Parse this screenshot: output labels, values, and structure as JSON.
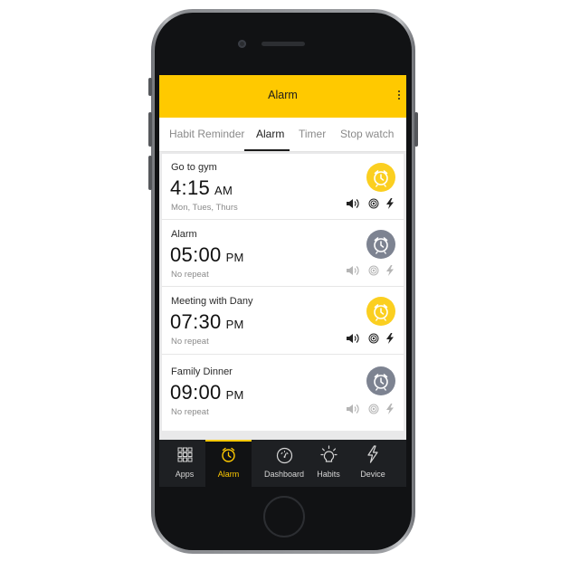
{
  "app": {
    "title": "Alarm"
  },
  "tabs": [
    {
      "label": "Habit Reminder",
      "active": false
    },
    {
      "label": "Alarm",
      "active": true
    },
    {
      "label": "Timer",
      "active": false
    },
    {
      "label": "Stop watch",
      "active": false
    }
  ],
  "alarms": [
    {
      "name": "Go to gym",
      "time": "4:15",
      "ampm": "AM",
      "repeat": "Mon, Tues, Thurs",
      "enabled": true
    },
    {
      "name": "Alarm",
      "time": "05:00",
      "ampm": "PM",
      "repeat": "No repeat",
      "enabled": false
    },
    {
      "name": "Meeting with Dany",
      "time": "07:30",
      "ampm": "PM",
      "repeat": "No repeat",
      "enabled": true
    },
    {
      "name": "Family Dinner",
      "time": "09:00",
      "ampm": "PM",
      "repeat": "No repeat",
      "enabled": false
    }
  ],
  "alarm_icons": [
    "alarm-clock-icon",
    "speaker-icon",
    "vibrate-icon",
    "flash-icon"
  ],
  "bottom_nav": [
    {
      "label": "Apps",
      "icon": "grid-icon",
      "active": false
    },
    {
      "label": "Alarm",
      "icon": "alarm-clock-icon",
      "active": true
    },
    {
      "label": "Dashboard",
      "icon": "gauge-icon",
      "active": false
    },
    {
      "label": "Habits",
      "icon": "lightbulb-icon",
      "active": false
    },
    {
      "label": "Device",
      "icon": "flash-icon",
      "active": false
    }
  ],
  "colors": {
    "accent": "#ffc900",
    "alarm_on": "#fbcf20",
    "alarm_off": "#7d8391",
    "nav_bg": "#1e2023"
  }
}
